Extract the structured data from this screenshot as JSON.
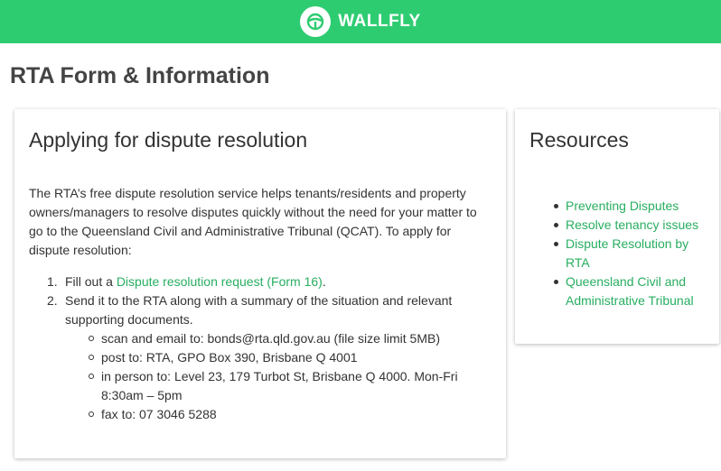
{
  "header": {
    "brand": "WALLFLY",
    "logo_icon": "wallfly-logo-icon",
    "brand_color": "#2ecc71"
  },
  "page": {
    "title": "RTA Form & Information"
  },
  "main_card": {
    "title": "Applying for dispute resolution",
    "intro": "The RTA’s free dispute resolution service helps tenants/residents and property owners/managers to resolve disputes quickly without the need for your matter to go to the Queensland Civil and Administrative Tribunal (QCAT). To apply for dispute resolution:",
    "steps": [
      {
        "number": "1.",
        "prefix": "Fill out a ",
        "link": "Dispute resolution request (Form 16)",
        "suffix": "."
      },
      {
        "number": "2.",
        "text": "Send it to the RTA along with a summary of the situation and relevant supporting documents.",
        "sub_items": [
          "scan and email to: bonds@rta.qld.gov.au (file size limit 5MB)",
          "post to: RTA, GPO Box 390, Brisbane Q 4001",
          "in person to: Level 23, 179 Turbot St, Brisbane Q 4000. Mon-Fri 8:30am – 5pm",
          "fax to: 07 3046 5288"
        ]
      }
    ]
  },
  "resources": {
    "title": "Resources",
    "links": [
      "Preventing Disputes",
      "Resolve tenancy issues",
      "Dispute Resolution by RTA",
      "Queensland Civil and Administrative Tribunal"
    ]
  },
  "colors": {
    "link": "#27ae60",
    "header_bg": "#2ecc71"
  }
}
